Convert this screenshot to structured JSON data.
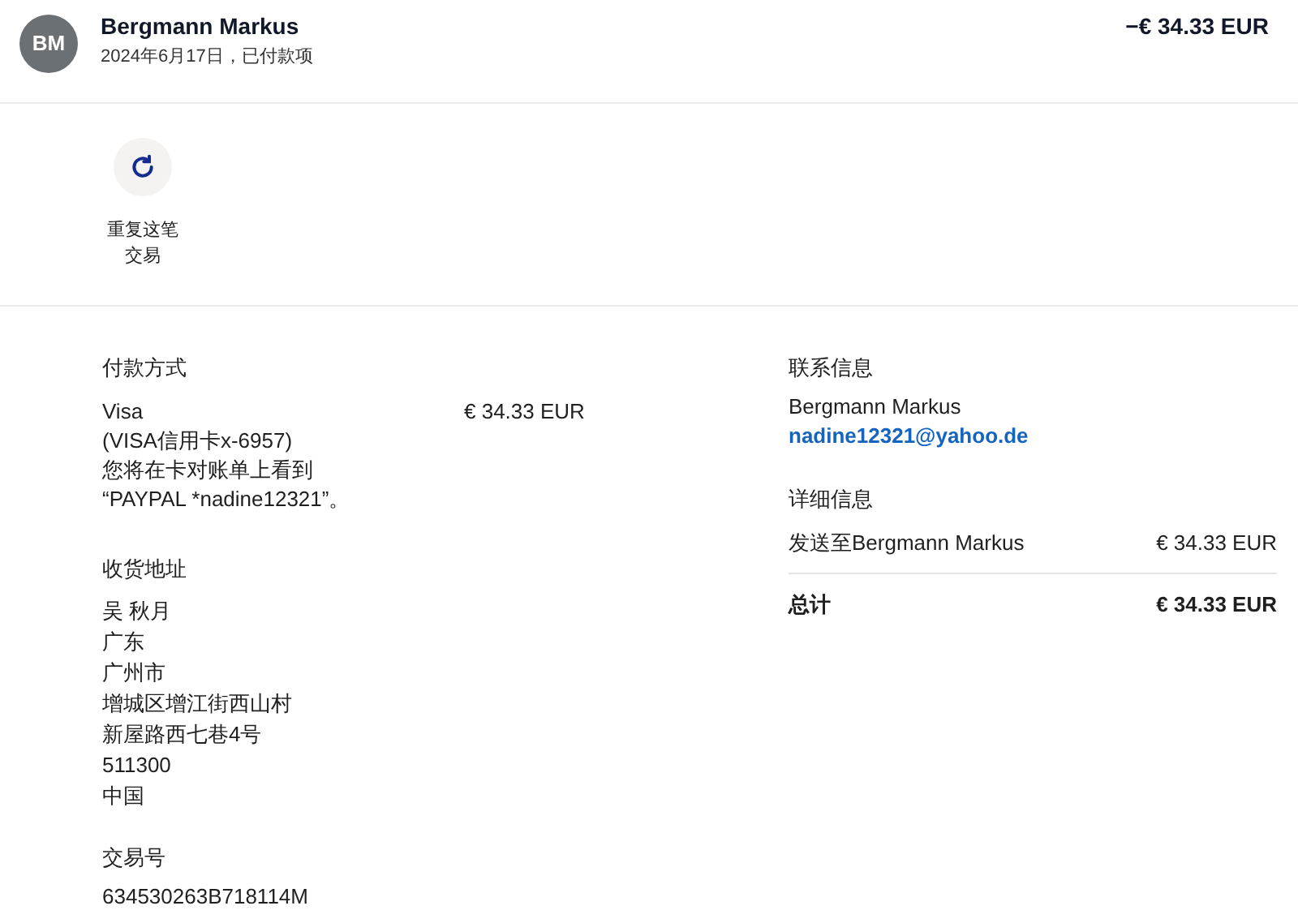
{
  "header": {
    "avatar": "BM",
    "name": "Bergmann Markus",
    "subtitle": "2024年6月17日，已付款项",
    "amount": "−€ 34.33 EUR"
  },
  "actions": [
    {
      "label": "重复这笔交易"
    }
  ],
  "payment": {
    "heading": "付款方式",
    "lines": [
      "Visa",
      "(VISA信用卡x-6957)",
      "您将在卡对账单上看到",
      "“PAYPAL *nadine12321”。"
    ],
    "amount": "€ 34.33 EUR"
  },
  "shipping": {
    "heading": "收货地址",
    "lines": [
      "吴 秋月",
      "广东",
      "广州市",
      "增城区增江街西山村",
      "新屋路西七巷4号",
      "511300",
      "中国"
    ]
  },
  "transaction": {
    "heading": "交易号",
    "id": "634530263B718114M"
  },
  "contact": {
    "heading": "联系信息",
    "name": "Bergmann Markus",
    "email": "nadine12321@yahoo.de"
  },
  "details": {
    "heading": "详细信息",
    "rows": [
      {
        "label": "发送至Bergmann Markus",
        "amount": "€ 34.33 EUR"
      }
    ],
    "total_label": "总计",
    "total_amount": "€ 34.33 EUR"
  }
}
